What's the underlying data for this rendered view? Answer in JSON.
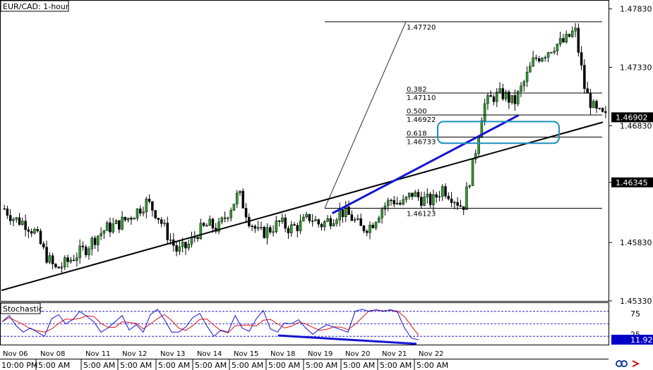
{
  "header": {
    "symbol_label": "EUR/CAD: 1-hour"
  },
  "colors": {
    "bull": "#2f9e2f",
    "bear": "#000000",
    "trend_blue": "#1414d2",
    "trend_black": "#000000",
    "zone_stroke": "#1a8fbf",
    "stoch_main": "#1414d2",
    "stoch_signal": "#e01414",
    "level_line": "#0000c8"
  },
  "chart_data": [
    {
      "type": "candlestick",
      "title": "EUR/CAD: 1-hour",
      "ylim": [
        1.4533,
        1.479
      ],
      "y_ticks": [
        "1.47830",
        "1.47330",
        "1.46830",
        "1.46345",
        "1.45830",
        "1.45330"
      ],
      "current_price": "1.46902",
      "marked_price": "1.46345",
      "x_date_labels": [
        "Nov 06",
        "Nov 08",
        "Nov 11",
        "Nov 12",
        "Nov 13",
        "Nov 14",
        "Nov 15",
        "Nov 18",
        "Nov 19",
        "Nov 20",
        "Nov 21",
        "Nov 22"
      ],
      "x_time_labels": [
        "10:00 PM",
        "5:00 AM",
        "5:00 AM",
        "5:00 AM",
        "5:00 AM",
        "5:00 AM",
        "5:00 AM",
        "5:00 AM",
        "5:00 AM",
        "5:00 AM",
        "5:00 AM",
        "5:00 AM"
      ],
      "close_path": [
        1.4612,
        1.4603,
        1.46,
        1.4592,
        1.4573,
        1.456,
        1.4565,
        1.4572,
        1.4578,
        1.4588,
        1.4595,
        1.4598,
        1.4603,
        1.461,
        1.4618,
        1.4607,
        1.459,
        1.4575,
        1.458,
        1.4592,
        1.4598,
        1.4595,
        1.461,
        1.4625,
        1.4603,
        1.459,
        1.4594,
        1.46,
        1.4595,
        1.4598,
        1.4605,
        1.4598,
        1.4603,
        1.461,
        1.4605,
        1.4595,
        1.4598,
        1.4612,
        1.462,
        1.4615,
        1.4625,
        1.462,
        1.4618,
        1.463,
        1.4622,
        1.4613,
        1.465,
        1.47,
        1.4708,
        1.471,
        1.4702,
        1.472,
        1.474,
        1.4745,
        1.4752,
        1.4755,
        1.4765,
        1.4712,
        1.4695,
        1.469
      ],
      "fibonacci": {
        "levels": [
          {
            "ratio": "",
            "price": "1.47720",
            "value": 1.4772
          },
          {
            "ratio": "0.382",
            "price": "1.47110",
            "value": 1.4711
          },
          {
            "ratio": "0.500",
            "price": "1.46922",
            "value": 1.46922
          },
          {
            "ratio": "0.618",
            "price": "1.46733",
            "value": 1.46733
          },
          {
            "ratio": "",
            "price": "1.46123",
            "value": 1.46123
          }
        ]
      },
      "trendlines": [
        {
          "name": "support-trendline",
          "color": "black",
          "from": [
            0,
            1.4542
          ],
          "to": [
            1,
            1.4686
          ]
        },
        {
          "name": "blue-trendline",
          "color": "blue",
          "from": [
            0.55,
            1.4608
          ],
          "to": [
            0.86,
            1.4692
          ]
        }
      ],
      "zone": {
        "y_top": 1.46865,
        "y_bottom": 1.4668
      }
    },
    {
      "type": "line",
      "title": "Stochastic",
      "ylim": [
        0,
        100
      ],
      "y_ticks": [
        "75",
        "25"
      ],
      "levels": [
        80,
        50,
        20
      ],
      "current_value": "11.92",
      "main_series": [
        55,
        70,
        45,
        30,
        40,
        30,
        20,
        62,
        72,
        50,
        60,
        80,
        68,
        55,
        30,
        40,
        55,
        70,
        35,
        48,
        30,
        72,
        85,
        60,
        30,
        30,
        42,
        65,
        75,
        45,
        20,
        35,
        30,
        70,
        40,
        32,
        62,
        82,
        38,
        30,
        52,
        50,
        60,
        40,
        25,
        38,
        48,
        42,
        36,
        30,
        80,
        85,
        80,
        84,
        80,
        84,
        78,
        40,
        15,
        11.92
      ],
      "trendline_stoch": {
        "from": [
          0.46,
          22
        ],
        "to": [
          0.69,
          2
        ]
      }
    }
  ]
}
